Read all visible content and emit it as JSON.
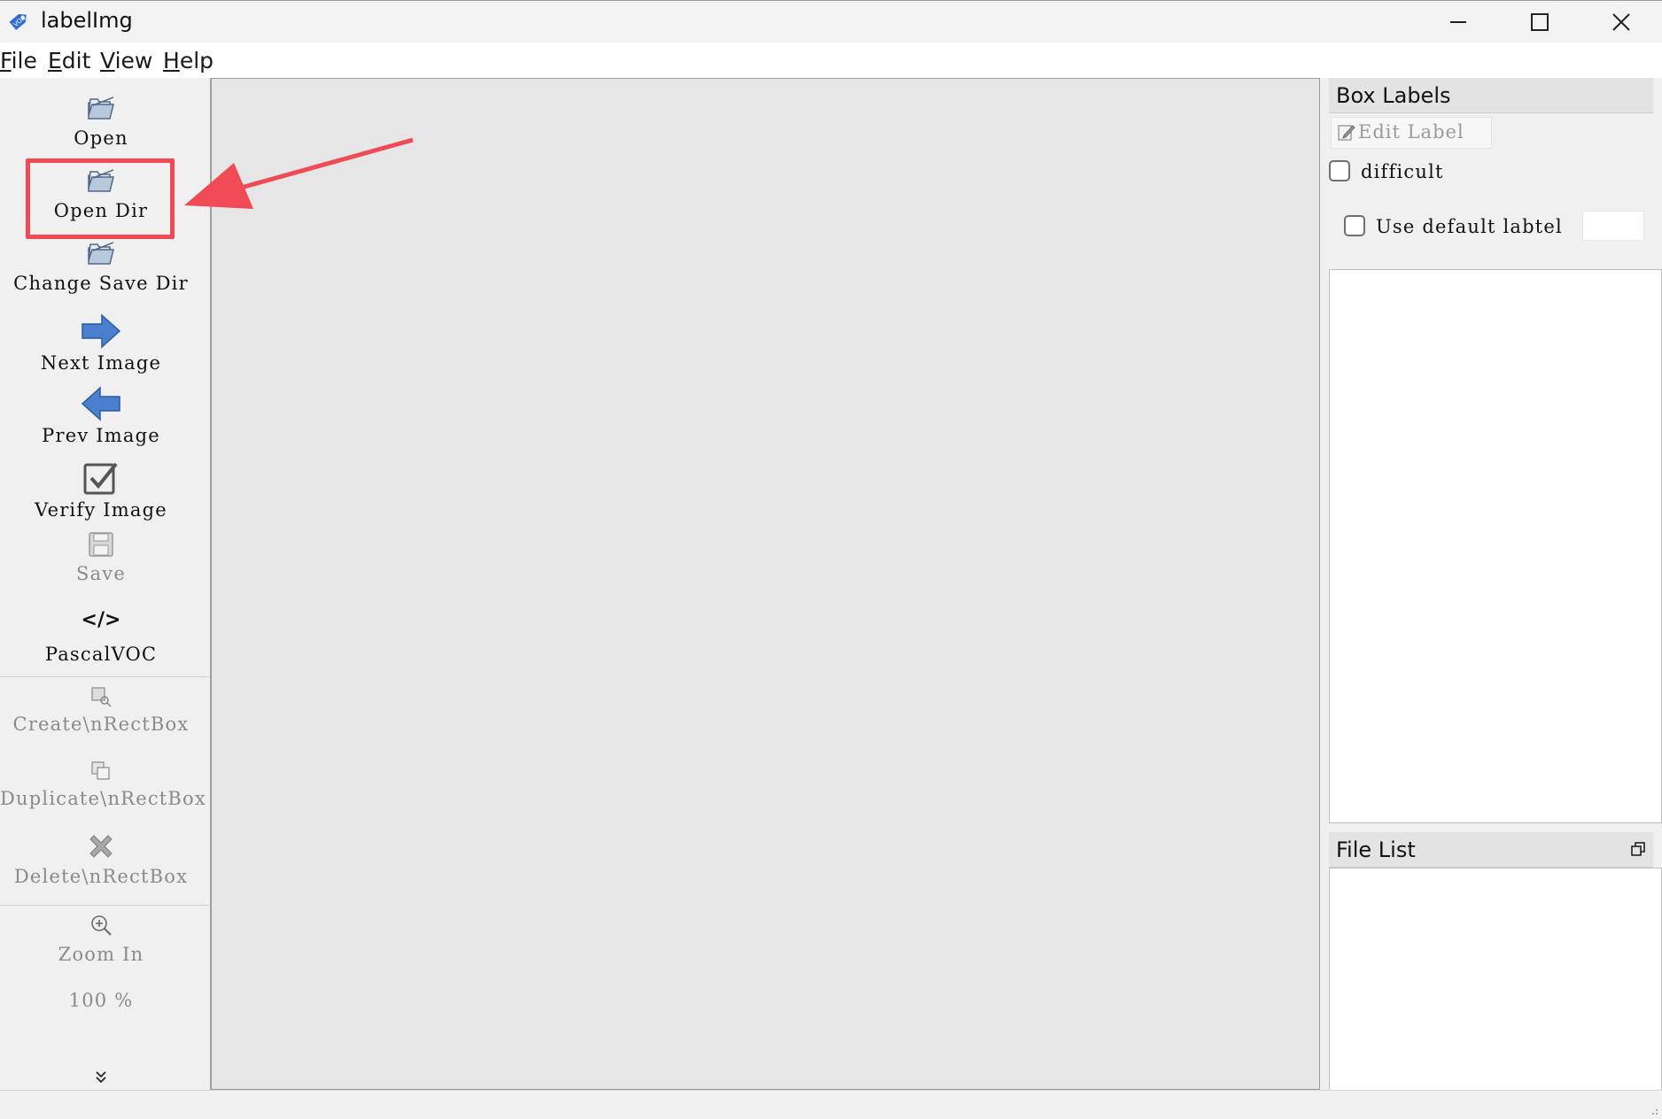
{
  "window": {
    "title": "labelImg",
    "icon": "voc-tag-icon"
  },
  "menu": {
    "file": "File",
    "edit": "Edit",
    "view": "View",
    "help": "Help"
  },
  "toolbar": {
    "open": "Open",
    "open_dir": "Open Dir",
    "change_save_dir": "Change Save Dir",
    "next_image": "Next Image",
    "prev_image": "Prev Image",
    "verify_image": "Verify Image",
    "save": "Save",
    "format_glyph": "</>",
    "format": "PascalVOC",
    "create_rect": "Create\\nRectBox",
    "duplicate_rect": "Duplicate\\nRectBox",
    "delete_rect": "Delete\\nRectBox",
    "zoom_in": "Zoom In",
    "zoom_level": "100 %"
  },
  "dock": {
    "box_labels_title": "Box Labels",
    "edit_label": "Edit Label",
    "difficult": "difficult",
    "use_default_label": "Use default labtel",
    "file_list_title": "File List"
  },
  "colors": {
    "highlight": "#f04b55",
    "arrow_icon": "#3b6fc4"
  }
}
